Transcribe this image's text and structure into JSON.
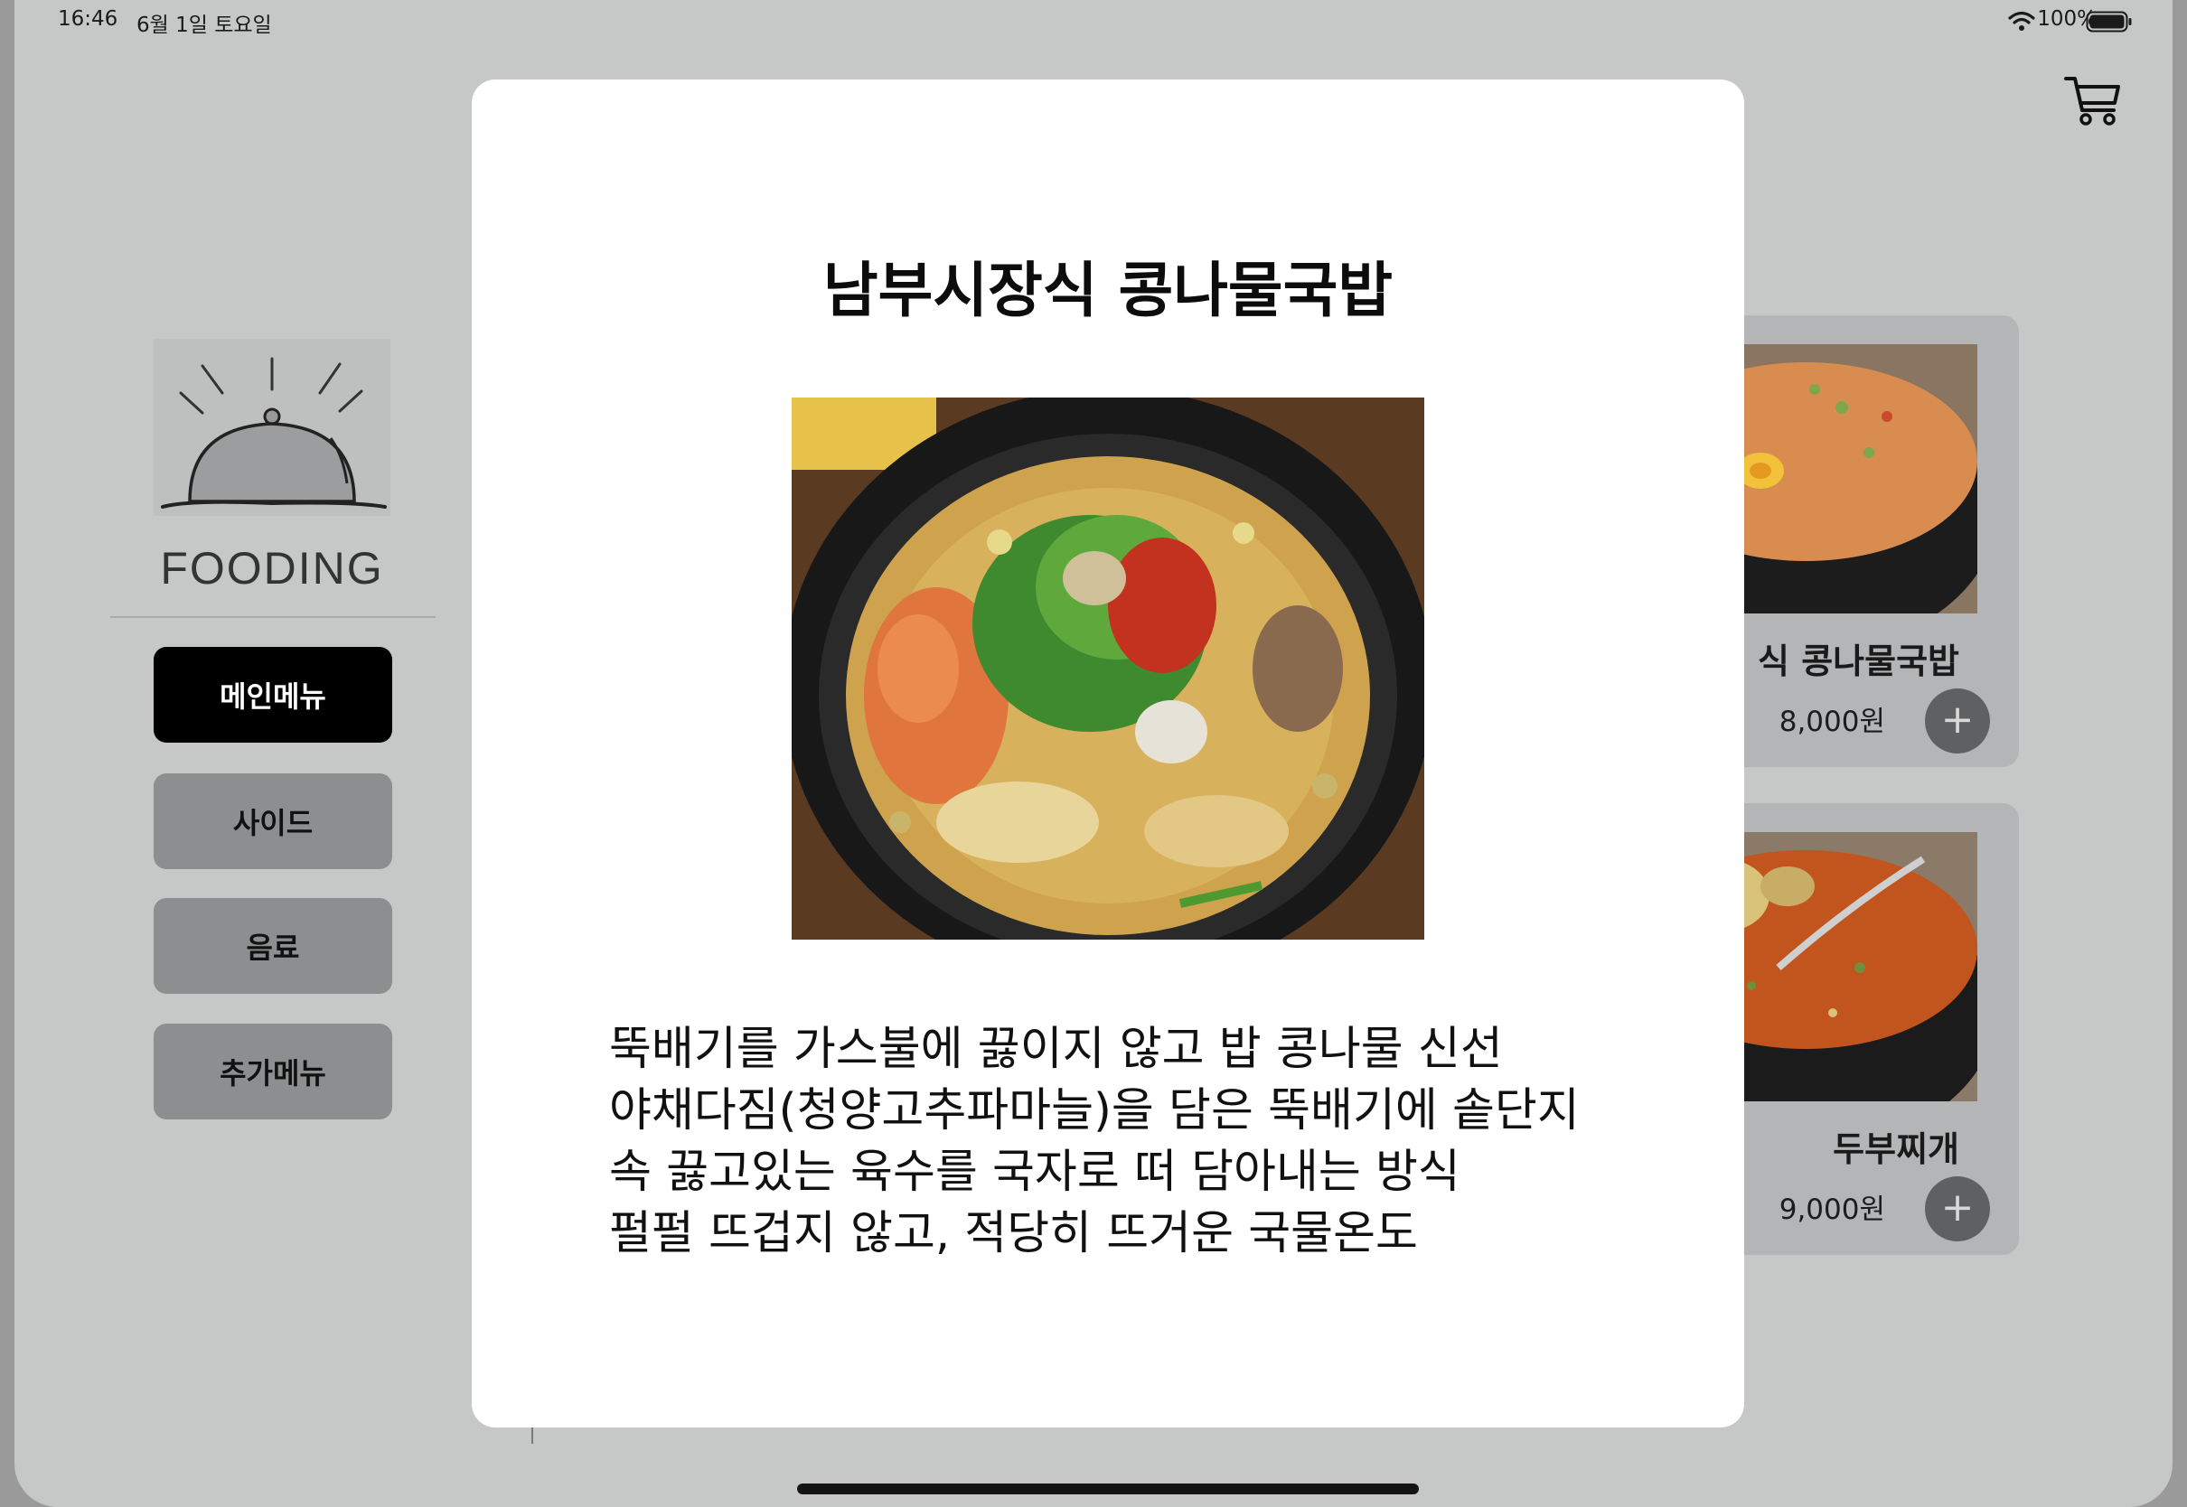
{
  "status_bar": {
    "time": "16:46",
    "date": "6월 1일 토요일",
    "battery_percent": "100%",
    "icons": [
      "wifi-icon",
      "battery-icon"
    ]
  },
  "header": {
    "cart_icon": "cart-icon"
  },
  "sidebar": {
    "brand": "FOODING",
    "logo_icon": "cloche-icon",
    "categories": [
      {
        "label": "메인메뉴",
        "active": true
      },
      {
        "label": "사이드",
        "active": false
      },
      {
        "label": "음료",
        "active": false
      },
      {
        "label": "추가메뉴",
        "active": false
      }
    ]
  },
  "menu_cards": [
    {
      "name": "남부시장식 콩나물국밥",
      "visible_name": "식 콩나물국밥",
      "visible_price": "8,000원",
      "add_icon": "plus-icon"
    },
    {
      "name": "두부찌개",
      "visible_name": "두부찌개",
      "visible_price": "9,000원",
      "add_icon": "plus-icon"
    }
  ],
  "modal": {
    "title": "남부시장식 콩나물국밥",
    "description_lines": [
      "뚝배기를 가스불에 끓이지 않고 밥 콩나물 신선",
      "야채다짐(청양고추파마늘)을 담은 뚝배기에 솥단지",
      "속 끓고있는 육수를 국자로 떠 담아내는 방식",
      "펄펄 뜨겁지 않고, 적당히 뜨거운 국물온도"
    ]
  },
  "colors": {
    "backdrop": "#c6c8c7",
    "active_category": "#000000",
    "inactive_category": "#8d8e8f",
    "modal_bg": "#ffffff",
    "add_button": "#5f6061"
  }
}
